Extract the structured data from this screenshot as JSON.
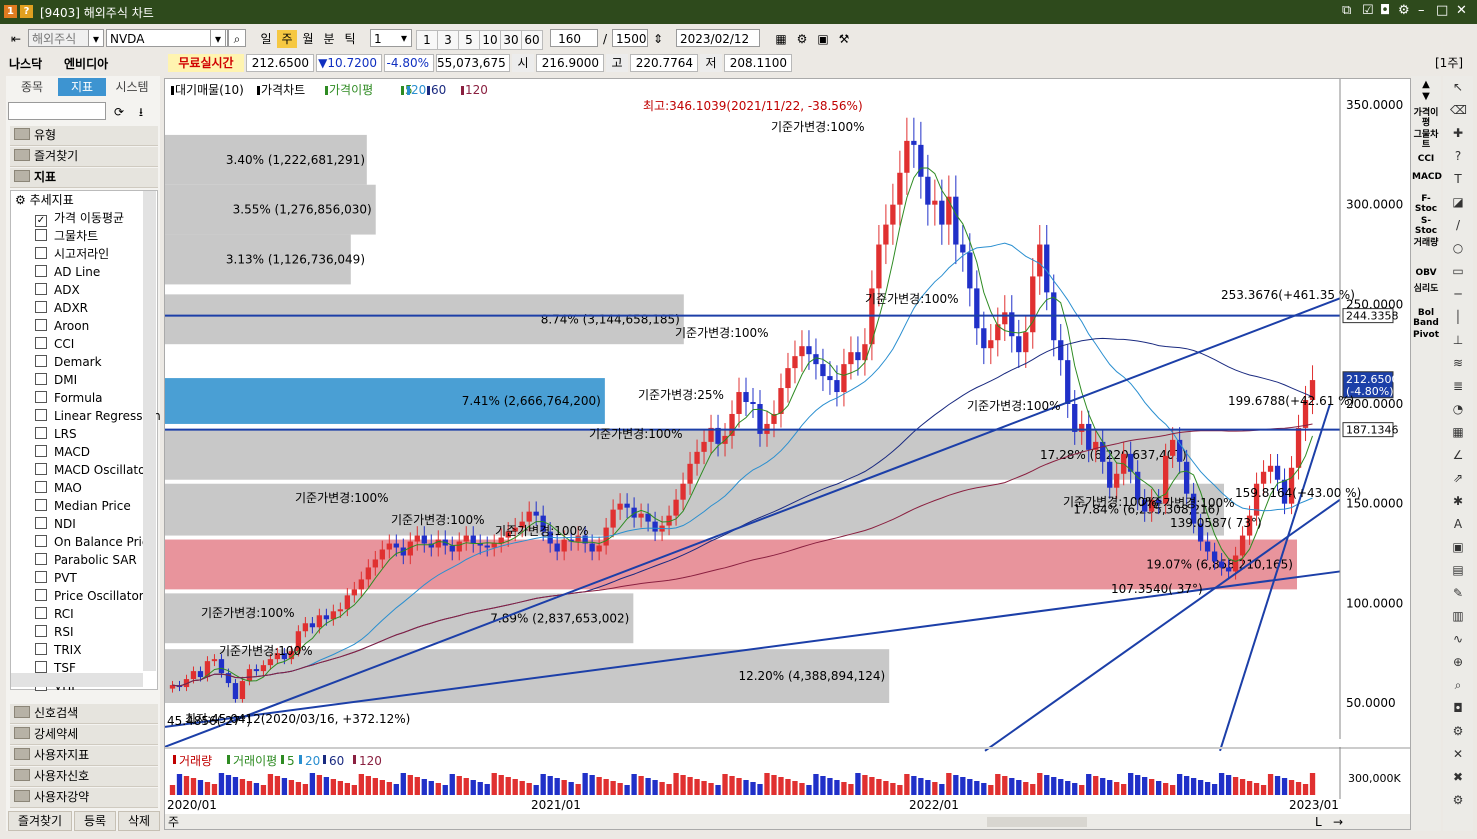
{
  "window": {
    "title": "[9403] 해외주식 차트",
    "badge1": "1",
    "badge2": "?"
  },
  "toolbar": {
    "market": "해외주식",
    "symbol": "NVDA",
    "periods": [
      "일",
      "주",
      "월",
      "분",
      "틱"
    ],
    "active_period": "주",
    "unit_value": "1",
    "unit_options": [
      "1",
      "3",
      "5",
      "10",
      "30",
      "60"
    ],
    "view_count": "160",
    "separator": "/",
    "total_count": "1500",
    "date": "2023/02/12"
  },
  "quote": {
    "exchange": "나스닥",
    "name": "엔비디아",
    "realtime_label": "무료실시간",
    "price": "212.6500",
    "change": "▼10.7200",
    "change_pct": "-4.80%",
    "volume": "55,073,675",
    "open_label": "시",
    "open": "216.9000",
    "high_label": "고",
    "high": "220.7764",
    "low_label": "저",
    "low": "208.1100",
    "period_badge": "[1주]"
  },
  "sidebar": {
    "tabs": [
      "종목",
      "지표",
      "시스템"
    ],
    "active_tab": "지표",
    "folders_top": [
      "유형",
      "즐겨찾기",
      "지표"
    ],
    "tree_root": "추세지표",
    "indicators": [
      {
        "name": "가격 이동평균",
        "checked": true
      },
      {
        "name": "그물차트",
        "checked": false
      },
      {
        "name": "시고저라인",
        "checked": false
      },
      {
        "name": "AD Line",
        "checked": false
      },
      {
        "name": "ADX",
        "checked": false
      },
      {
        "name": "ADXR",
        "checked": false
      },
      {
        "name": "Aroon",
        "checked": false
      },
      {
        "name": "CCI",
        "checked": false
      },
      {
        "name": "Demark",
        "checked": false
      },
      {
        "name": "DMI",
        "checked": false
      },
      {
        "name": "Formula",
        "checked": false
      },
      {
        "name": "Linear Regression",
        "checked": false
      },
      {
        "name": "LRS",
        "checked": false
      },
      {
        "name": "MACD",
        "checked": false
      },
      {
        "name": "MACD Oscillator",
        "checked": false
      },
      {
        "name": "MAO",
        "checked": false
      },
      {
        "name": "Median Price",
        "checked": false
      },
      {
        "name": "NDI",
        "checked": false
      },
      {
        "name": "On Balance Price",
        "checked": false
      },
      {
        "name": "Parabolic SAR",
        "checked": false
      },
      {
        "name": "PVT",
        "checked": false
      },
      {
        "name": "Price Oscillator",
        "checked": false
      },
      {
        "name": "RCI",
        "checked": false
      },
      {
        "name": "RSI",
        "checked": false
      },
      {
        "name": "TRIX",
        "checked": false
      },
      {
        "name": "TSF",
        "checked": false
      },
      {
        "name": "VHF",
        "checked": false
      }
    ],
    "folders_bottom": [
      "신호검색",
      "강세약세",
      "사용자지표",
      "사용자신호",
      "사용자강약"
    ],
    "bottom_buttons": [
      "즐겨찾기",
      "등록",
      "삭제"
    ]
  },
  "chart_legend": {
    "items": [
      "대기매물(10)",
      "가격차트",
      "가격이평",
      "5",
      "20",
      "60",
      "120"
    ]
  },
  "chart_data": {
    "type": "candlestick",
    "price_axis": {
      "ticks": [
        "350.0000",
        "300.0000",
        "250.0000",
        "200.0000",
        "150.0000",
        "100.0000",
        "50.0000"
      ],
      "range": [
        28,
        362
      ]
    },
    "x_ticks": [
      "2020/01",
      "2021/01",
      "2022/01",
      "2023/01"
    ],
    "price_markers": [
      {
        "label": "244.3358",
        "value": 244.3358
      },
      {
        "label": "212.6500",
        "sub": "(-4.80%)",
        "value": 212.65
      },
      {
        "label": "187.1346",
        "value": 187.1346
      }
    ],
    "annotations": {
      "high": "최고:346.1039(2021/11/22, -38.56%)",
      "low": "최저:45.0412(2020/03/16, +372.12%)",
      "trend_labels": [
        "253.3676(+461.35 %)",
        "199.6788(+42.61 %)",
        "159.8164(+43.00 %)",
        "139.0587( 73°)",
        "107.3540( 37°)",
        "45.4856( 27°)"
      ],
      "base_change": [
        "기준가변경:100%",
        "기준가변경:100%",
        "기준가변경:100%",
        "기준가변경:25%",
        "기준가변경:100%",
        "기준가변경:100%",
        "기준가변경:100%",
        "기준가변경:100%",
        "기준가변경:100%",
        "기준가변경:100%",
        "기준가변경:100%",
        "기준가변경:100%",
        "기준가변경:100%"
      ]
    },
    "volume_profile": [
      {
        "label": "3.40% (1,222,681,291)",
        "pct": 3.4,
        "low": 310,
        "high": 335
      },
      {
        "label": "3.55% (1,276,856,030)",
        "pct": 3.55,
        "low": 285,
        "high": 310
      },
      {
        "label": "3.13% (1,126,736,049)",
        "pct": 3.13,
        "low": 260,
        "high": 285
      },
      {
        "label": "8.74% (3,144,658,185)",
        "pct": 8.74,
        "low": 230,
        "high": 255
      },
      {
        "label": "7.41% (2,666,764,200)",
        "pct": 7.41,
        "low": 190,
        "high": 213
      },
      {
        "label": "17.28% (6,220,637,407)",
        "pct": 17.28,
        "low": 162,
        "high": 187
      },
      {
        "label": "17.84% (6,235,308,216)",
        "pct": 17.84,
        "low": 134,
        "high": 160
      },
      {
        "label": "19.07% (6,858,210,165)",
        "pct": 19.07,
        "low": 107,
        "high": 132
      },
      {
        "label": "7.89% (2,837,653,002)",
        "pct": 7.89,
        "low": 80,
        "high": 105
      },
      {
        "label": "12.20% (4,388,894,124)",
        "pct": 12.2,
        "low": 50,
        "high": 77
      }
    ],
    "candles_weekly_close_approx": [
      59,
      58,
      62,
      66,
      63,
      71,
      72,
      65,
      60,
      52,
      61,
      67,
      66,
      69,
      72,
      75,
      72,
      76,
      86,
      90,
      88,
      94,
      92,
      96,
      97,
      104,
      107,
      112,
      118,
      122,
      127,
      130,
      128,
      124,
      131,
      134,
      130,
      128,
      132,
      129,
      126,
      131,
      134,
      130,
      129,
      128,
      130,
      133,
      136,
      138,
      141,
      146,
      144,
      136,
      130,
      126,
      132,
      131,
      134,
      130,
      126,
      129,
      138,
      147,
      150,
      148,
      143,
      145,
      141,
      136,
      139,
      144,
      152,
      160,
      170,
      176,
      181,
      188,
      180,
      184,
      195,
      206,
      201,
      200,
      185,
      190,
      195,
      208,
      218,
      224,
      229,
      225,
      220,
      214,
      212,
      206,
      220,
      226,
      222,
      230,
      258,
      280,
      290,
      300,
      316,
      332,
      330,
      314,
      300,
      302,
      290,
      304,
      280,
      276,
      258,
      238,
      228,
      232,
      240,
      246,
      234,
      226,
      236,
      264,
      280,
      256,
      232,
      222,
      200,
      186,
      190,
      177,
      181,
      171,
      158,
      165,
      175,
      166,
      152,
      146,
      152,
      150,
      174,
      182,
      171,
      155,
      140,
      131,
      126,
      121,
      118,
      116,
      124,
      134,
      144,
      160,
      166,
      169,
      162,
      150,
      168,
      188,
      202,
      212
    ],
    "volume": {
      "label": "거래량",
      "legend": [
        "거래이평",
        "5",
        "20",
        "60",
        "120"
      ],
      "tick": "300,000K"
    }
  },
  "volume_legend": [
    "거래량",
    "거래이평",
    "5",
    "20",
    "60",
    "120"
  ],
  "right_panel": [
    "가격이평",
    "그물차트",
    "CCI",
    "MACD",
    "F-Stoc",
    "S-Stoc",
    "거래량",
    "OBV",
    "심리도",
    "Bol Band",
    "Pivot"
  ],
  "bottom_bar": {
    "left": "주",
    "mode": "L",
    "arrow": "→"
  },
  "colors": {
    "up": "#e03030",
    "down": "#2030c8",
    "profile": "#c8c8c8",
    "profile_hl": "#4a9fd4",
    "profile_red": "#e8949c",
    "trendline": "#1c3fa8"
  }
}
